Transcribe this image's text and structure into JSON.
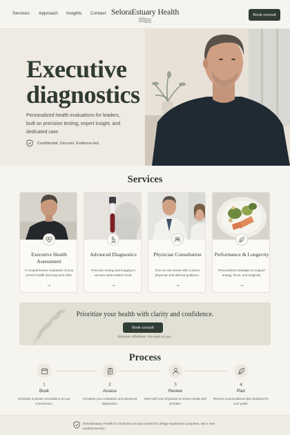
{
  "nav": {
    "links": [
      "Services",
      "Approach",
      "Insights",
      "Contact"
    ],
    "brand": "SeloraEstuary Health",
    "cta_label": "Book consult"
  },
  "hero": {
    "title_line1": "Executive",
    "title_line2": "diagnostics",
    "subtitle": "Personalized health evaluations for leaders, built on precision testing, expert insight, and dedicated care.",
    "badge": "Confidential. Discreet. Evidence-led."
  },
  "services": {
    "title": "Services",
    "cards": [
      {
        "title": "Executive Health Assessment",
        "desc": "A comprehensive evaluation of your current health and long-term risks.",
        "icon": "heart-pulse-icon"
      },
      {
        "title": "Advanced Diagnostics",
        "desc": "Precision testing and imaging to uncover what matters most.",
        "icon": "microscope-icon"
      },
      {
        "title": "Physician Consultation",
        "desc": "One-on-one review with a senior physician and tailored guidance.",
        "icon": "people-icon"
      },
      {
        "title": "Performance & Longevity",
        "desc": "Personalized strategies to support energy, focus, and longevity.",
        "icon": "leaf-icon"
      }
    ],
    "arrow": "→"
  },
  "cta": {
    "title": "Prioritize your health with clarity and confidence.",
    "button": "Book consult",
    "note": "Discreet. Effortless. Focused on you."
  },
  "process": {
    "title": "Process",
    "steps": [
      {
        "num": "1",
        "title": "Book",
        "desc": "Schedule a private consultation at your convenience.",
        "icon": "calendar-icon"
      },
      {
        "num": "2",
        "title": "Assess",
        "desc": "Complete your evaluation and advanced diagnostics.",
        "icon": "clipboard-icon"
      },
      {
        "num": "3",
        "title": "Review",
        "desc": "Meet with your physician to review results and priorities.",
        "icon": "person-icon"
      },
      {
        "num": "4",
        "title": "Plan",
        "desc": "Receive a personalized plan designed for your goals.",
        "icon": "leaf-icon"
      }
    ]
  },
  "footer": {
    "text": "SeloraEstuary Health is a fictional concept created for design exploration purposes. Not a real medical service."
  },
  "colors": {
    "accent": "#2f3d35",
    "background": "#f6f4ef",
    "cta_band": "#e2e0d5"
  }
}
